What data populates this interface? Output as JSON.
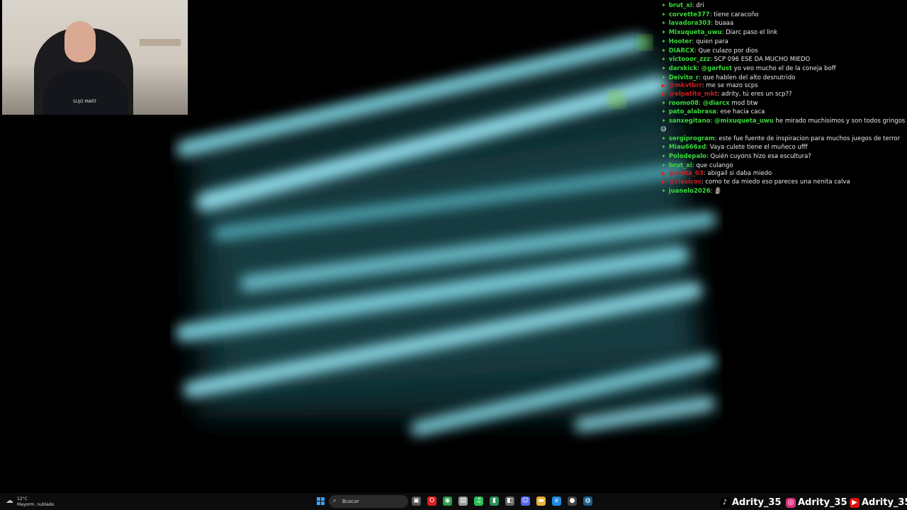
{
  "webcam": {
    "shirt_text": "SUJO MART"
  },
  "chat": {
    "messages": [
      {
        "platform": "twitch",
        "user": "brut_xi",
        "text": "dri"
      },
      {
        "platform": "twitch",
        "user": "corvette377",
        "text": "tiene caracoño"
      },
      {
        "platform": "twitch",
        "user": "lavadora303",
        "text": "buaaa"
      },
      {
        "platform": "twitch",
        "user": "Mixuqueta_uwu",
        "text": "Diarc paso el link"
      },
      {
        "platform": "twitch",
        "user": "Hooter",
        "text": "quien para"
      },
      {
        "platform": "twitch",
        "user": "DIARCX",
        "text": "Que culazo por dios"
      },
      {
        "platform": "twitch",
        "user": "victooor_zzz",
        "text": "SCP 096 ESE DA MUCHO MIEDO"
      },
      {
        "platform": "twitch",
        "user": "darskick",
        "mention": "@garfust",
        "text": " yo veo mucho el de la coneja boff"
      },
      {
        "platform": "twitch",
        "user": "Deivito_r",
        "text": "que hablen del alto desnutrido"
      },
      {
        "platform": "youtube",
        "user": "@mkvtbrr",
        "text": "me se mazo scps"
      },
      {
        "platform": "youtube",
        "user": "@elpatito_mkt",
        "text": "adrity, tú eres un scp??"
      },
      {
        "platform": "twitch",
        "user": "roomo08",
        "mention": "@diarcx",
        "text": " mod btw"
      },
      {
        "platform": "twitch",
        "user": "pato_alabrasa",
        "text": "ese hacia caca"
      },
      {
        "platform": "twitch",
        "user": "sanxegitano",
        "mention": "@mixuqueta_uwu",
        "text": " he mirado muchisimos y son todos gringos 😅"
      },
      {
        "platform": "twitch",
        "user": "sergiprogram",
        "text": "este fue fuente de inspiracion para muchos juegos de terror"
      },
      {
        "platform": "twitch",
        "user": "Miau666xd",
        "text": "Vaya culete tiene el muñeco ufff"
      },
      {
        "platform": "twitch",
        "user": "Polodepalo",
        "text": "Quién cuyons hizo esa escultura?"
      },
      {
        "platform": "twitch",
        "user": "brut_xi",
        "text": "que culango"
      },
      {
        "platform": "youtube",
        "user": "@anita_03",
        "text": "abigail si daba miedo"
      },
      {
        "platform": "youtube",
        "user": "@clasicos",
        "text": "como te da miedo eso pareces una nenita calva"
      },
      {
        "platform": "twitch",
        "user": "juanelo2026",
        "text": "🗿"
      }
    ]
  },
  "taskbar": {
    "weather_temp": "12°C",
    "weather_desc": "Mayorm. nublado",
    "search_placeholder": "Buscar",
    "apps": [
      {
        "name": "task-view-icon",
        "color": "#555"
      },
      {
        "name": "opera-icon",
        "color": "#d82020"
      },
      {
        "name": "chrome-icon",
        "color": "#2e9a4a"
      },
      {
        "name": "file-icon",
        "color": "#999"
      },
      {
        "name": "spotify-icon",
        "color": "#2bbd55"
      },
      {
        "name": "phone-link-icon",
        "color": "#2f8f5f"
      },
      {
        "name": "store-icon",
        "color": "#666"
      },
      {
        "name": "discord-icon",
        "color": "#5865f2"
      },
      {
        "name": "folder-icon",
        "color": "#e8b33a"
      },
      {
        "name": "edge-icon",
        "color": "#1f8ae0"
      },
      {
        "name": "obs-icon",
        "color": "#444"
      },
      {
        "name": "steam-icon",
        "color": "#1b5d8c"
      }
    ]
  },
  "socials": {
    "tiktok": "Adrity_35",
    "instagram": "Adrity_35",
    "youtube": "Adrity_35"
  }
}
